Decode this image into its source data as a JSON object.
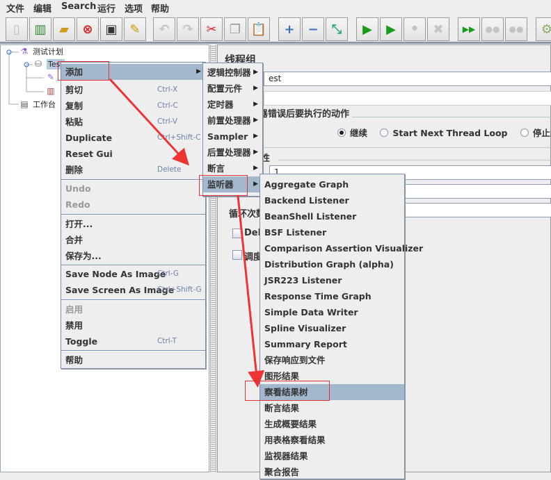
{
  "menubar": [
    "文件",
    "编辑",
    "Search",
    "运行",
    "选项",
    "帮助"
  ],
  "toolbar": {
    "icons": [
      "new-icon",
      "templates-icon",
      "open-icon",
      "close-icon",
      "save-icon",
      "save-as-icon",
      "undo-icon",
      "redo-icon",
      "cut-icon",
      "copy-icon",
      "paste-icon",
      "expand-icon",
      "collapse-icon",
      "toggle-icon",
      "start-icon",
      "start-no-pause-icon",
      "stop-icon",
      "shutdown-icon",
      "remote-start-icon",
      "remote-stop-icon",
      "remote-shutdown-icon",
      "settings-icon"
    ]
  },
  "tree": {
    "root": "测试计划",
    "thread_group": "Test",
    "workbench": "工作台"
  },
  "panel": {
    "title": "线程组",
    "name_value": "est",
    "error_action_label": "在取样器错误后要执行的动作",
    "radio": [
      "继续",
      "Start Next Thread Loop",
      "停止线程"
    ],
    "radio_selected": "继续",
    "threads_label_partial": "性",
    "threads_value": "1",
    "loop_label": "循环次数",
    "delay_label": "Dela",
    "scheduler_label": "调度"
  },
  "context_menu": {
    "items": [
      {
        "label": "添加",
        "submenu": true
      },
      {
        "label": "剪切",
        "shortcut": "Ctrl-X"
      },
      {
        "label": "复制",
        "shortcut": "Ctrl-C"
      },
      {
        "label": "粘贴",
        "shortcut": "Ctrl-V"
      },
      {
        "label": "Duplicate",
        "shortcut": "Ctrl+Shift-C"
      },
      {
        "label": "Reset Gui"
      },
      {
        "label": "删除",
        "shortcut": "Delete"
      },
      {
        "label": "Undo",
        "disabled": true
      },
      {
        "label": "Redo",
        "disabled": true
      },
      {
        "label": "打开..."
      },
      {
        "label": "合并"
      },
      {
        "label": "保存为..."
      },
      {
        "label": "Save Node As Image",
        "shortcut": "Ctrl-G"
      },
      {
        "label": "Save Screen As Image",
        "shortcut": "Ctrl+Shift-G"
      },
      {
        "label": "启用",
        "disabled": true
      },
      {
        "label": "禁用"
      },
      {
        "label": "Toggle",
        "shortcut": "Ctrl-T"
      },
      {
        "label": "帮助"
      }
    ]
  },
  "add_submenu": [
    "逻辑控制器",
    "配置元件",
    "定时器",
    "前置处理器",
    "Sampler",
    "后置处理器",
    "断言",
    "监听器"
  ],
  "listener_submenu": [
    "Aggregate Graph",
    "Backend Listener",
    "BeanShell Listener",
    "BSF Listener",
    "Comparison Assertion Visualizer",
    "Distribution Graph (alpha)",
    "JSR223 Listener",
    "Response Time Graph",
    "Simple Data Writer",
    "Spline Visualizer",
    "Summary Report",
    "保存响应到文件",
    "图形结果",
    "察看结果树",
    "断言结果",
    "生成概要结果",
    "用表格察看结果",
    "监视器结果",
    "聚合报告"
  ],
  "colors": {
    "highlight": "#a3b8cc",
    "annotation": "#e53333"
  }
}
